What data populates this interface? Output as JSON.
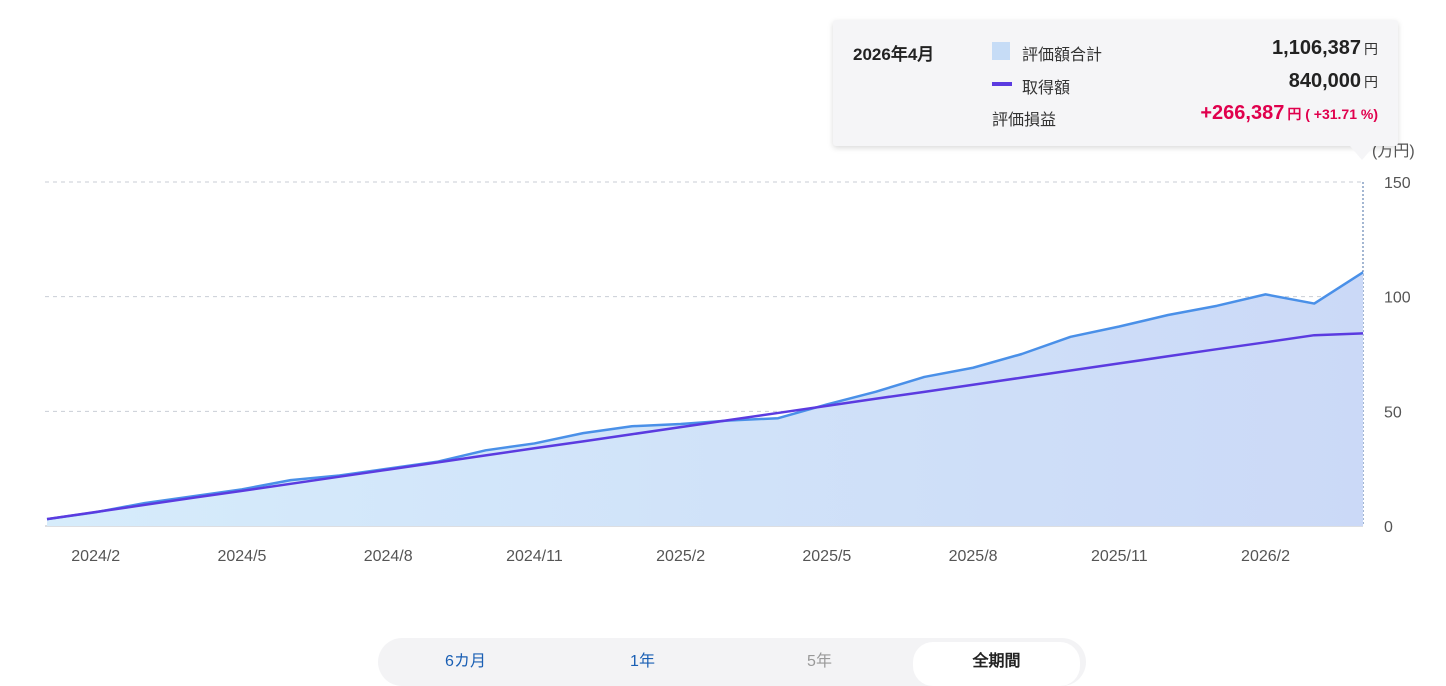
{
  "chart_data": {
    "type": "area",
    "unit_label": "(万円)",
    "yticks": [
      "150",
      "100",
      "50",
      "0"
    ],
    "ylim": [
      0,
      150
    ],
    "x_tick_labels": [
      "2024/2",
      "2024/5",
      "2024/8",
      "2024/11",
      "2025/2",
      "2025/5",
      "2025/8",
      "2025/11",
      "2026/2"
    ],
    "x_months": [
      "2024/1",
      "2024/2",
      "2024/3",
      "2024/4",
      "2024/5",
      "2024/6",
      "2024/7",
      "2024/8",
      "2024/9",
      "2024/10",
      "2024/11",
      "2024/12",
      "2025/1",
      "2025/2",
      "2025/3",
      "2025/4",
      "2025/5",
      "2025/6",
      "2025/7",
      "2025/8",
      "2025/9",
      "2025/10",
      "2025/11",
      "2025/12",
      "2026/1",
      "2026/2",
      "2026/3",
      "2026/4"
    ],
    "grid": true,
    "series": [
      {
        "name": "評価額合計",
        "color": "#4a90e8",
        "fill": "#c6dcf6",
        "values": [
          3,
          6,
          10,
          13,
          16,
          20,
          22,
          25,
          28,
          33,
          36,
          40.5,
          43.5,
          44.5,
          46,
          47,
          53,
          58.5,
          65,
          69,
          75,
          82.5,
          87,
          92,
          96,
          101,
          97,
          110.6
        ]
      },
      {
        "name": "取得額",
        "color": "#5b3be0",
        "values": [
          3,
          6.1,
          9.2,
          12.3,
          15.3,
          18.4,
          21.5,
          24.6,
          27.7,
          30.8,
          33.9,
          36.9,
          40,
          43.1,
          46.2,
          49.3,
          52.4,
          55.5,
          58.5,
          61.6,
          64.7,
          67.8,
          70.9,
          74,
          77.1,
          80.1,
          83.2,
          84
        ]
      }
    ]
  },
  "tooltip": {
    "date": "2026年4月",
    "rows": [
      {
        "label": "評価額合計",
        "value": "1,106,387",
        "unit": "円"
      },
      {
        "label": "取得額",
        "value": "840,000",
        "unit": "円"
      }
    ],
    "profit": {
      "label": "評価損益",
      "value": "+266,387",
      "unit": "円 ( +31.71 %)"
    }
  },
  "tabs": [
    {
      "label": "6カ月",
      "state": "link"
    },
    {
      "label": "1年",
      "state": "link"
    },
    {
      "label": "5年",
      "state": "disabled"
    },
    {
      "label": "全期間",
      "state": "active"
    }
  ]
}
